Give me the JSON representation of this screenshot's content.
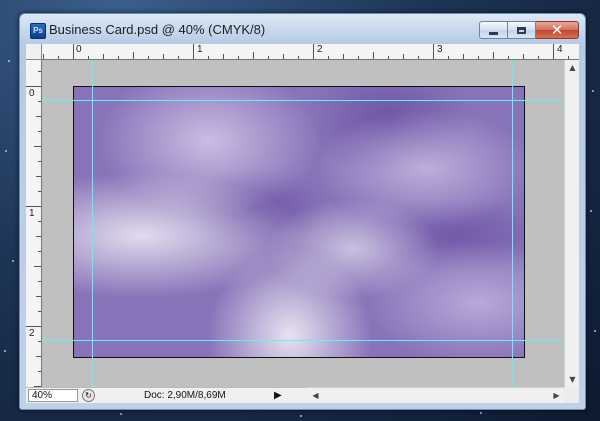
{
  "window": {
    "app_icon": "Ps",
    "title": "Business Card.psd @ 40% (CMYK/8)",
    "buttons": {
      "minimize": "minimize-icon",
      "maximize": "maximize-icon",
      "close": "close-icon"
    }
  },
  "ruler": {
    "horizontal_labels": [
      "0",
      "1",
      "2",
      "3",
      "4"
    ],
    "vertical_labels": [
      "0",
      "1",
      "2"
    ]
  },
  "status": {
    "zoom": "40%",
    "doc_info": "Doc: 2,90M/8,69M"
  },
  "colors": {
    "guide": "#5ff0ff",
    "canvas_background": "#c0c0c0",
    "document_base": "#8873b8"
  }
}
